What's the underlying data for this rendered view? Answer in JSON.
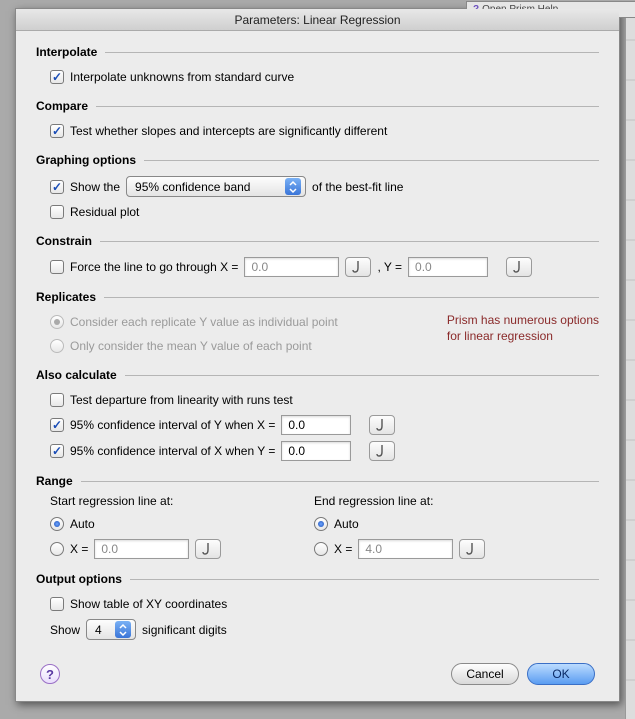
{
  "menu_hint": {
    "icon": "help-icon",
    "label": "Open Prism Help"
  },
  "title": "Parameters: Linear Regression",
  "interpolate": {
    "heading": "Interpolate",
    "cb1_checked": true,
    "cb1_label": "Interpolate unknowns from standard curve"
  },
  "compare": {
    "heading": "Compare",
    "cb1_checked": true,
    "cb1_label": "Test whether slopes and intercepts are significantly different"
  },
  "graphing": {
    "heading": "Graphing options",
    "show_checked": true,
    "show_prefix": "Show the",
    "band_value": "95% confidence band",
    "show_suffix": "of the best-fit line",
    "residual_checked": false,
    "residual_label": "Residual plot"
  },
  "constrain": {
    "heading": "Constrain",
    "cb_checked": false,
    "prefix": "Force the line to go through X =",
    "x_value": "0.0",
    "mid": ", Y =",
    "y_value": "0.0"
  },
  "replicates": {
    "heading": "Replicates",
    "r1_selected": true,
    "r1_label": "Consider each replicate Y value as individual point",
    "r2_selected": false,
    "r2_label": "Only consider the mean Y value of each point",
    "annotation_l1": "Prism has numerous options",
    "annotation_l2": "for linear regression"
  },
  "also": {
    "heading": "Also calculate",
    "runs_checked": false,
    "runs_label": "Test departure from linearity with runs test",
    "ciY_checked": true,
    "ciY_label": "95% confidence interval of Y when X =",
    "ciY_value": "0.0",
    "ciX_checked": true,
    "ciX_label": "95% confidence interval of X when Y =",
    "ciX_value": "0.0"
  },
  "range": {
    "heading": "Range",
    "start_label": "Start regression line at:",
    "end_label": "End regression line at:",
    "auto_label": "Auto",
    "x_label": "X =",
    "start_auto": true,
    "start_x": "0.0",
    "end_auto": true,
    "end_x": "4.0"
  },
  "output": {
    "heading": "Output options",
    "table_checked": false,
    "table_label": "Show table of XY coordinates",
    "show_label": "Show",
    "digits_value": "4",
    "digits_suffix": "significant digits"
  },
  "footer": {
    "help": "?",
    "cancel": "Cancel",
    "ok": "OK"
  }
}
